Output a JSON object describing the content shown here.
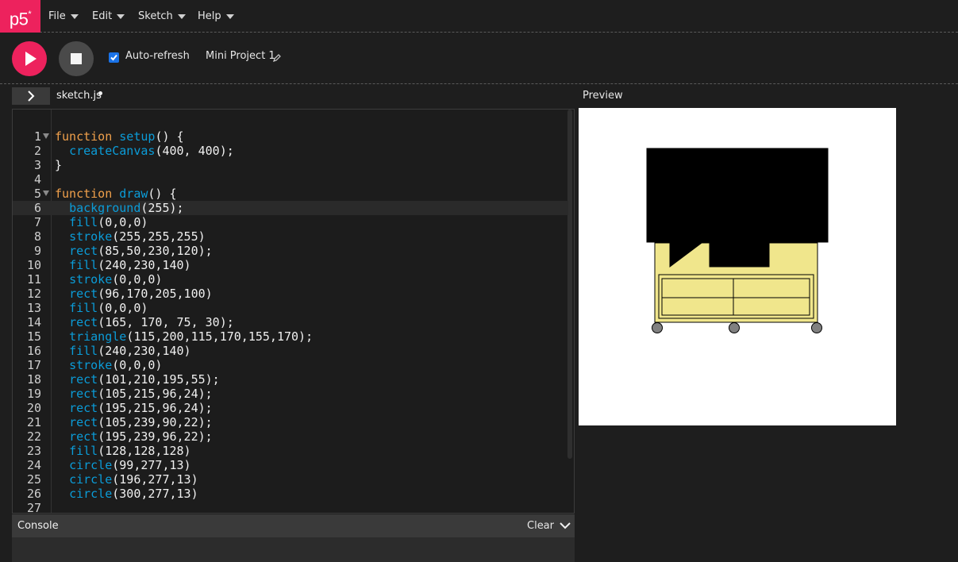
{
  "logo": "p5*",
  "menu": [
    {
      "label": "File"
    },
    {
      "label": "Edit"
    },
    {
      "label": "Sketch"
    },
    {
      "label": "Help"
    }
  ],
  "toolbar": {
    "autorefresh_label": "Auto-refresh",
    "autorefresh_checked": true,
    "project_name": "Mini Project 1"
  },
  "editor": {
    "file_tab": "sketch.js",
    "lines": [
      {
        "n": "1",
        "fold": true,
        "code": "function setup() {"
      },
      {
        "n": "2",
        "code": "  createCanvas(400, 400);"
      },
      {
        "n": "3",
        "code": "}"
      },
      {
        "n": "4",
        "code": ""
      },
      {
        "n": "5",
        "fold": true,
        "code": "function draw() {"
      },
      {
        "n": "6",
        "active": true,
        "code": "  background(255);"
      },
      {
        "n": "7",
        "code": "  fill(0,0,0)"
      },
      {
        "n": "8",
        "code": "  stroke(255,255,255)"
      },
      {
        "n": "9",
        "code": "  rect(85,50,230,120);"
      },
      {
        "n": "10",
        "code": "  fill(240,230,140)"
      },
      {
        "n": "11",
        "code": "  stroke(0,0,0)"
      },
      {
        "n": "12",
        "code": "  rect(96,170,205,100)"
      },
      {
        "n": "13",
        "code": "  fill(0,0,0)"
      },
      {
        "n": "14",
        "code": "  rect(165, 170, 75, 30);"
      },
      {
        "n": "15",
        "code": "  triangle(115,200,115,170,155,170);"
      },
      {
        "n": "16",
        "code": "  fill(240,230,140)"
      },
      {
        "n": "17",
        "code": "  stroke(0,0,0)"
      },
      {
        "n": "18",
        "code": "  rect(101,210,195,55);"
      },
      {
        "n": "19",
        "code": "  rect(105,215,96,24);"
      },
      {
        "n": "20",
        "code": "  rect(195,215,96,24);"
      },
      {
        "n": "21",
        "code": "  rect(105,239,90,22);"
      },
      {
        "n": "22",
        "code": "  rect(195,239,96,22);"
      },
      {
        "n": "23",
        "code": "  fill(128,128,128)"
      },
      {
        "n": "24",
        "code": "  circle(99,277,13)"
      },
      {
        "n": "25",
        "code": "  circle(196,277,13)"
      },
      {
        "n": "26",
        "code": "  circle(300,277,13)"
      },
      {
        "n": "27",
        "code": ""
      }
    ]
  },
  "preview_label": "Preview",
  "console": {
    "title": "Console",
    "clear_label": "Clear"
  },
  "colors": {
    "accent": "#ed225d",
    "keyword": "#f0a04b",
    "function": "#0b9cd8"
  }
}
